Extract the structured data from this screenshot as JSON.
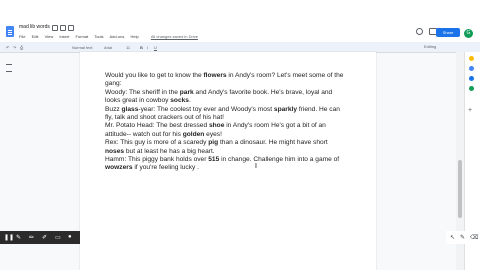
{
  "doc": {
    "title": "mad lib words",
    "edit_status": "All changes saved in Drive"
  },
  "menu": [
    "File",
    "Edit",
    "View",
    "Insert",
    "Format",
    "Tools",
    "Add-ons",
    "Help"
  ],
  "toolbar": {
    "style": "Normal text",
    "font": "Arial",
    "size": "11",
    "editing_mode": "Editing"
  },
  "header": {
    "share_label": "Share",
    "avatar_initial": "G"
  },
  "document_paragraphs": [
    [
      "Would you like to get to know the ",
      {
        "b": "flowers"
      },
      " in Andy's room? Let's meet some of the gang:"
    ],
    [
      "Woody: The sheriff in the ",
      {
        "b": "park"
      },
      " and Andy's favorite book. He's brave, loyal and looks great in cowboy ",
      {
        "b": "socks"
      },
      "."
    ],
    [
      "Buzz ",
      {
        "b": "glass"
      },
      "-year: The coolest toy ever and Woody's most ",
      {
        "b": "sparkly"
      },
      " friend. He can fly, talk and shoot crackers out of his hat!"
    ],
    [
      "Mr. Potato Head: The best dressed ",
      {
        "b": "shoe"
      },
      " in Andy's room He's got a bit of an attitude-- watch out for his ",
      {
        "b": "golden"
      },
      " eyes!"
    ],
    [
      "Rex:  This guy is more of a scaredy ",
      {
        "b": "pig"
      },
      " than a dinosaur. He might have short ",
      {
        "b": "noses"
      },
      " but at least he has a big heart."
    ],
    [
      "Hamm:  This piggy bank holds over ",
      {
        "b": "515"
      },
      " in change. Challenge him into a game of ",
      {
        "b": "wowzers"
      },
      " if you're feeling lucky ."
    ]
  ],
  "colors": {
    "share": "#1a73e8",
    "avatar": "#0f9d58",
    "annotation_bar": "#2b2b2b"
  }
}
